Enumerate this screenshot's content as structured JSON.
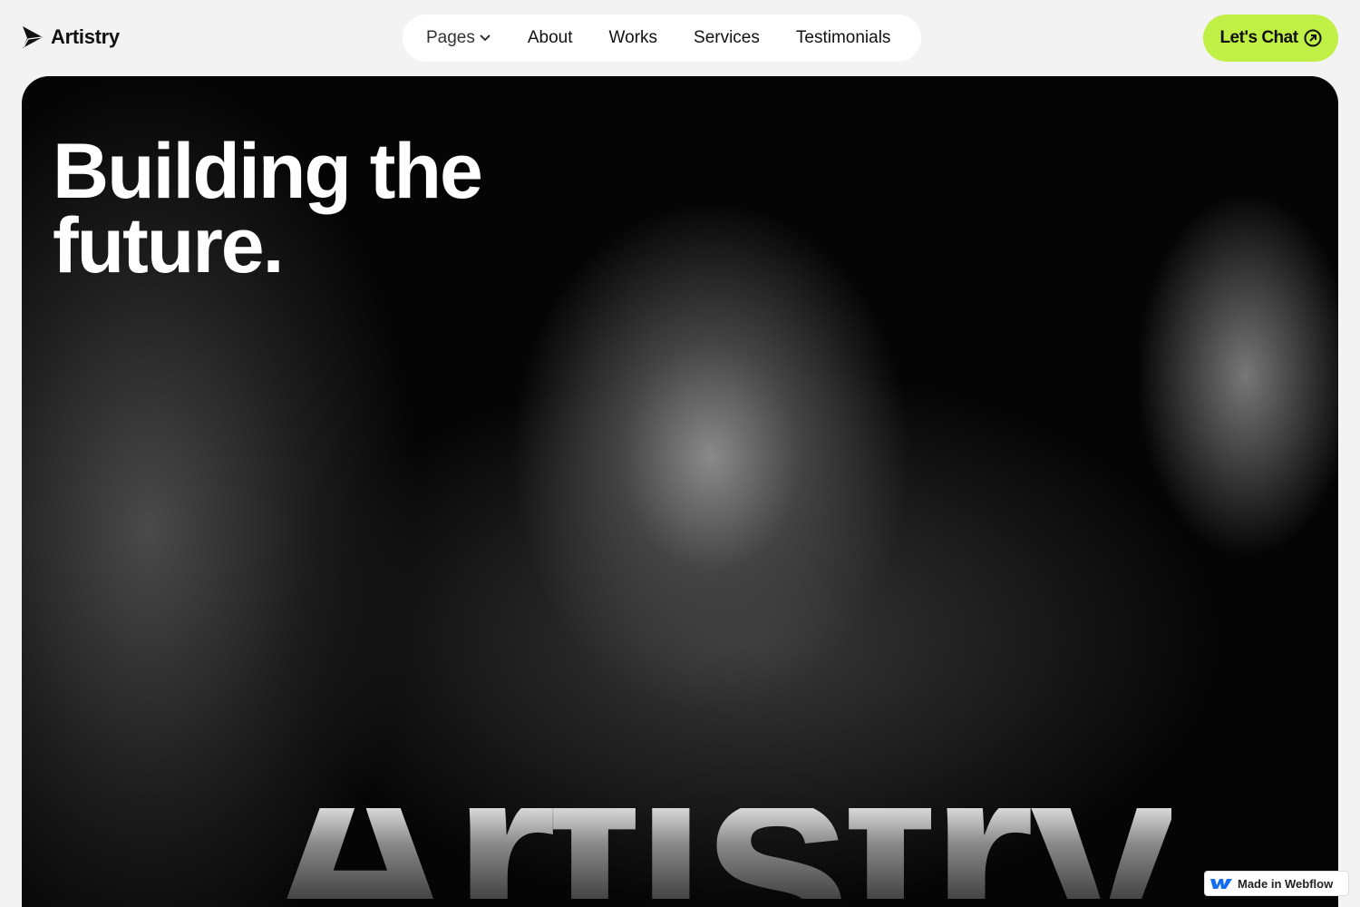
{
  "brand": {
    "name": "Artistry"
  },
  "nav": {
    "items": [
      {
        "label": "Pages"
      },
      {
        "label": "About"
      },
      {
        "label": "Works"
      },
      {
        "label": "Services"
      },
      {
        "label": "Testimonials"
      }
    ]
  },
  "cta": {
    "label": "Let's Chat"
  },
  "hero": {
    "headline_line1": "Building the",
    "headline_line2": "future.",
    "big_word": "Artistry"
  },
  "badge": {
    "label": "Made in Webflow"
  },
  "colors": {
    "accent": "#c0ef45",
    "webflow": "#146ef5"
  }
}
